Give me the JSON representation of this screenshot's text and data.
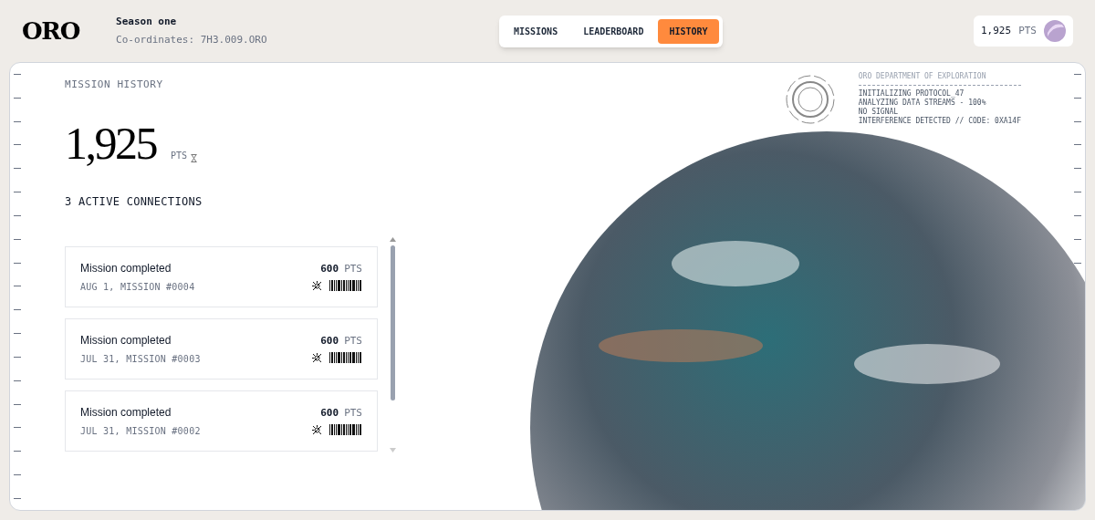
{
  "header": {
    "logo": "ORO",
    "season": "Season one",
    "coordinates": "Co-ordinates: 7H3.009.ORO"
  },
  "tabs": [
    {
      "label": "MISSIONS",
      "selected": false
    },
    {
      "label": "LEADERBOARD",
      "selected": false
    },
    {
      "label": "HISTORY",
      "selected": true
    }
  ],
  "points_badge": {
    "value": "1,925",
    "unit": "PTS"
  },
  "panel": {
    "title": "MISSION HISTORY",
    "total": "1,925",
    "total_unit": "PTS",
    "connections": "3 ACTIVE CONNECTIONS"
  },
  "missions": [
    {
      "title": "Mission completed",
      "subtitle": "AUG 1, MISSION #0004",
      "points": "600",
      "unit": "PTS"
    },
    {
      "title": "Mission completed",
      "subtitle": "JUL 31, MISSION #0003",
      "points": "600",
      "unit": "PTS"
    },
    {
      "title": "Mission completed",
      "subtitle": "JUL 31, MISSION #0002",
      "points": "600",
      "unit": "PTS"
    }
  ],
  "console": {
    "heading": "ORO DEPARTMENT OF EXPLORATION",
    "lines": [
      "INITIALIZING PROTOCOL_47",
      "ANALYZING DATA STREAMS - 100%",
      "NO SIGNAL",
      "INTERFERENCE DETECTED // CODE: 0XA14F"
    ]
  }
}
